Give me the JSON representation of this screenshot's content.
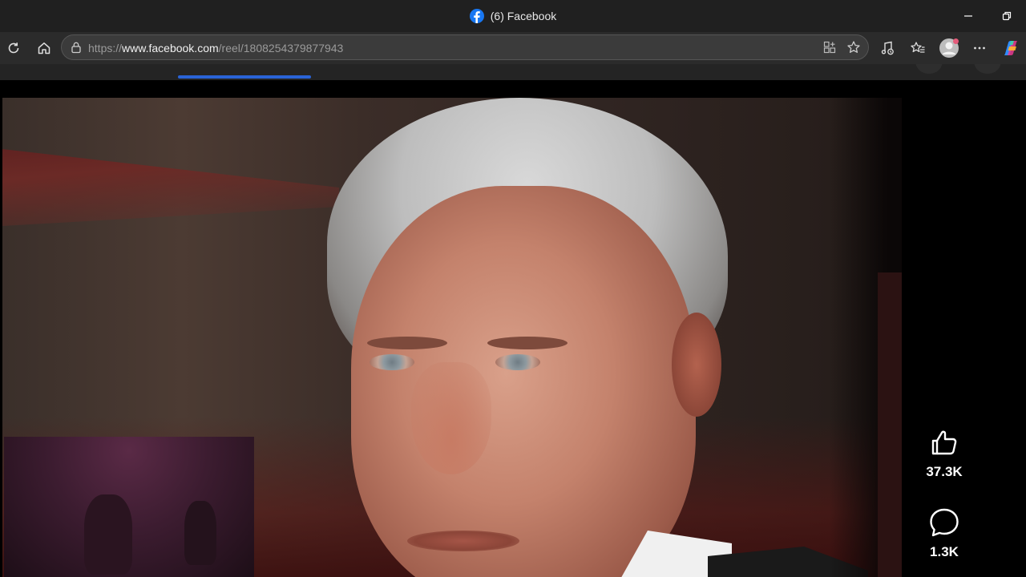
{
  "window": {
    "title": "(6) Facebook",
    "favicon": "facebook-favicon"
  },
  "window_controls": [
    "minimize-icon",
    "restore-icon"
  ],
  "toolbar": {
    "url_prefix": "https://",
    "url_domain": "www.facebook.com",
    "url_path": "/reel/1808254379877943",
    "buttons": [
      "refresh-icon",
      "home-icon"
    ],
    "address_icons": [
      "app-available-icon",
      "favorite-star-icon"
    ],
    "right_icons": [
      "media-control-icon",
      "favorites-icon",
      "profile-avatar",
      "more-icon",
      "copilot-icon"
    ]
  },
  "colors": {
    "accent": "#2a63d6",
    "facebook": "#1877f2"
  },
  "reel": {
    "like_count": "37.3K",
    "comment_count": "1.3K"
  }
}
